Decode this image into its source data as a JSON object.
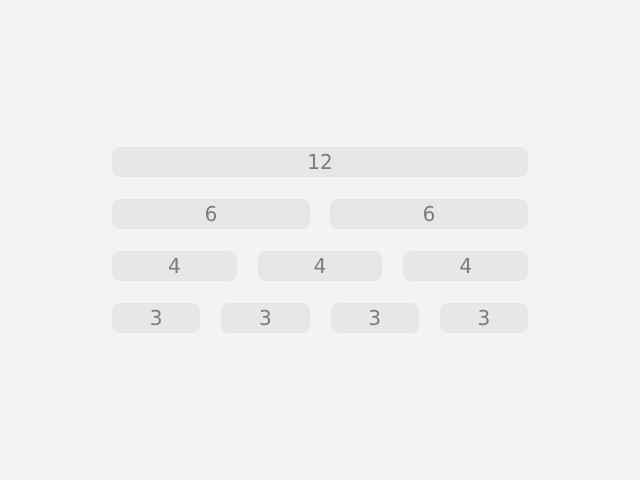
{
  "grid": {
    "rows": [
      {
        "cells": [
          "12"
        ]
      },
      {
        "cells": [
          "6",
          "6"
        ]
      },
      {
        "cells": [
          "4",
          "4",
          "4"
        ]
      },
      {
        "cells": [
          "3",
          "3",
          "3",
          "3"
        ]
      }
    ]
  }
}
